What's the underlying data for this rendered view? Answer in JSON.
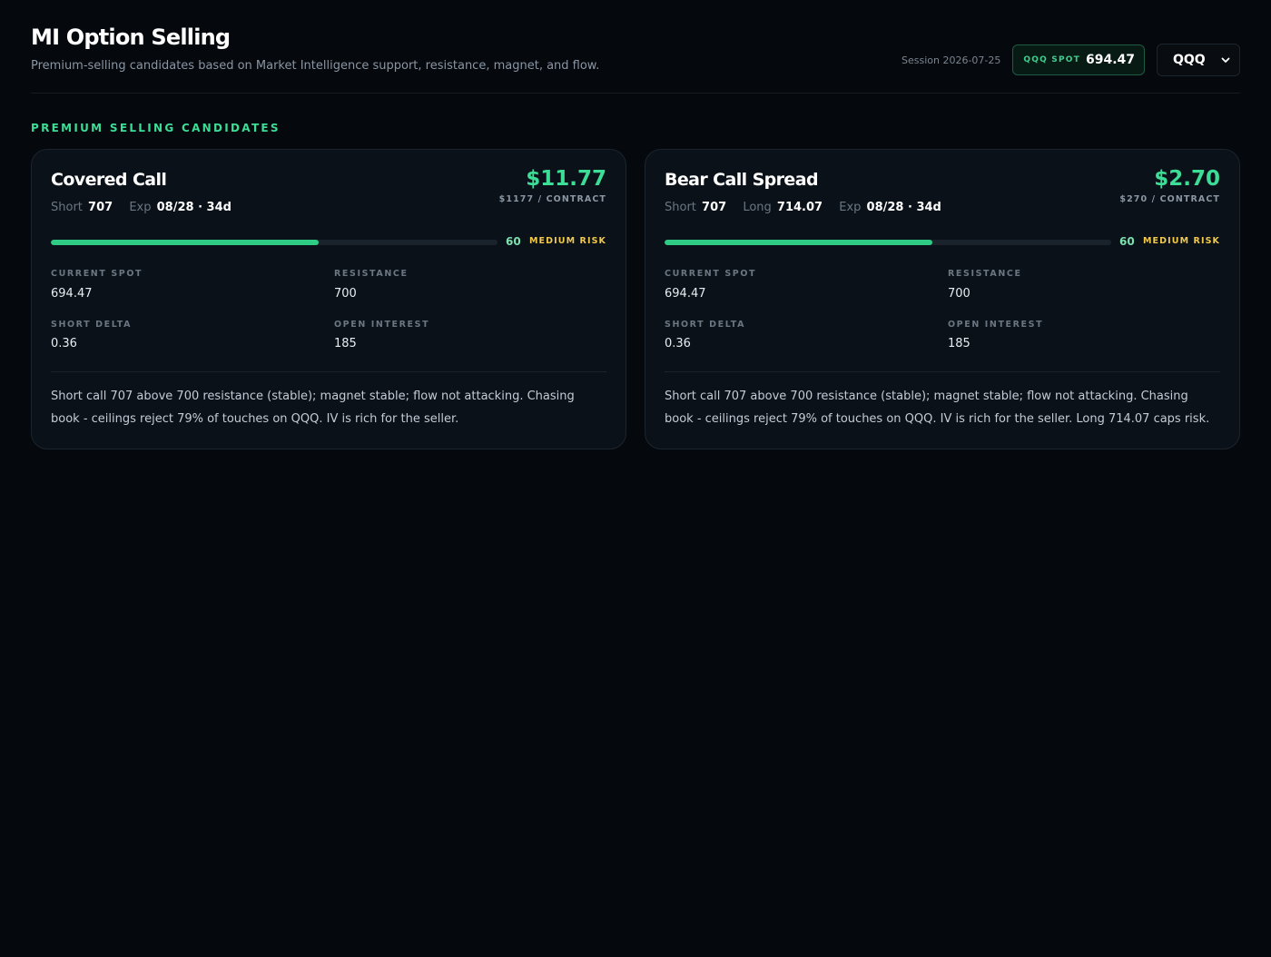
{
  "header": {
    "title": "MI Option Selling",
    "subtitle": "Premium-selling candidates based on Market Intelligence support, resistance, magnet, and flow.",
    "session": "Session 2026-07-25",
    "spot_label": "QQQ SPOT",
    "spot_value": "694.47",
    "ticker": "QQQ",
    "ticker_icon": "chevron-down-icon"
  },
  "section": {
    "title": "PREMIUM SELLING CANDIDATES"
  },
  "colors": {
    "accent": "#3ddc97",
    "risk_medium": "#f2c94c",
    "background": "#05080c",
    "card": "#0a1118"
  },
  "cards": [
    {
      "title": "Covered Call",
      "premium": "$11.77",
      "per_contract": "$1177 / CONTRACT",
      "short_label": "Short",
      "short_value": "707",
      "long_label": "",
      "long_value": "",
      "exp_label": "Exp",
      "exp_value": "08/28 · 34d",
      "risk_score": 60,
      "risk_label": "MEDIUM RISK",
      "metrics": {
        "current_spot_label": "CURRENT SPOT",
        "current_spot": "694.47",
        "resistance_label": "RESISTANCE",
        "resistance": "700",
        "short_delta_label": "SHORT DELTA",
        "short_delta": "0.36",
        "open_interest_label": "OPEN INTEREST",
        "open_interest": "185"
      },
      "note": "Short call 707 above 700 resistance (stable); magnet stable; flow not attacking. Chasing book - ceilings reject 79% of touches on QQQ. IV is rich for the seller."
    },
    {
      "title": "Bear Call Spread",
      "premium": "$2.70",
      "per_contract": "$270 / CONTRACT",
      "short_label": "Short",
      "short_value": "707",
      "long_label": "Long",
      "long_value": "714.07",
      "exp_label": "Exp",
      "exp_value": "08/28 · 34d",
      "risk_score": 60,
      "risk_label": "MEDIUM RISK",
      "metrics": {
        "current_spot_label": "CURRENT SPOT",
        "current_spot": "694.47",
        "resistance_label": "RESISTANCE",
        "resistance": "700",
        "short_delta_label": "SHORT DELTA",
        "short_delta": "0.36",
        "open_interest_label": "OPEN INTEREST",
        "open_interest": "185"
      },
      "note": "Short call 707 above 700 resistance (stable); magnet stable; flow not attacking. Chasing book - ceilings reject 79% of touches on QQQ. IV is rich for the seller. Long 714.07 caps risk."
    }
  ]
}
